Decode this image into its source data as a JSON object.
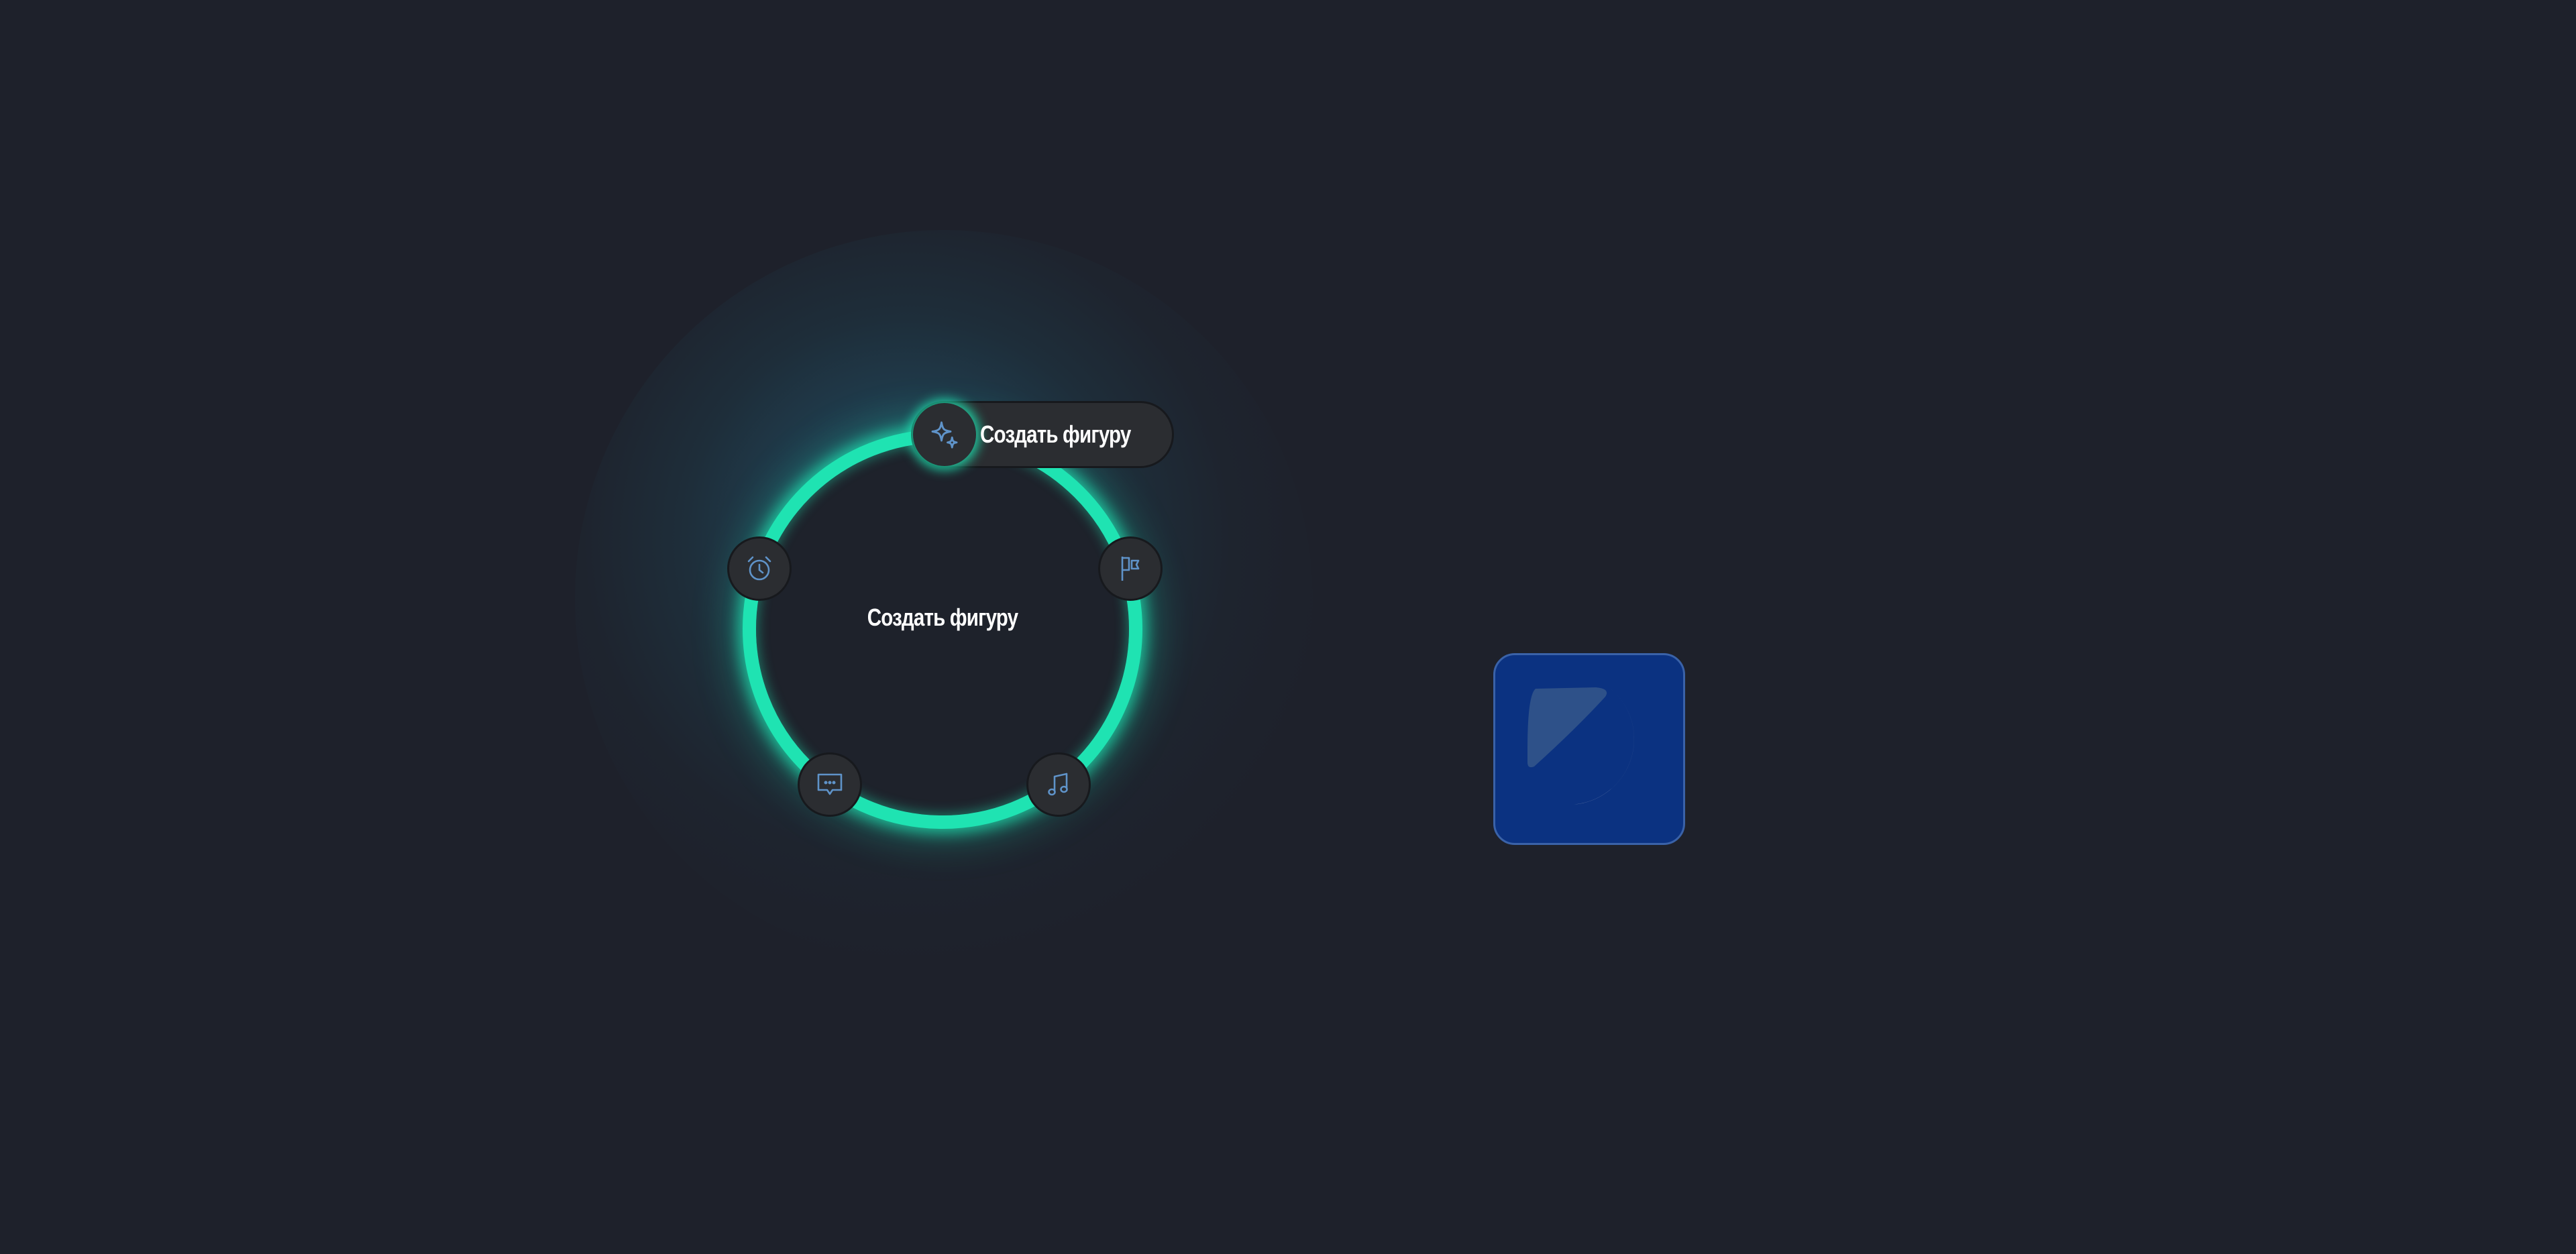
{
  "menu": {
    "center_label": "Создать фигуру",
    "active_item": {
      "label": "Создать фигуру",
      "icon": "sparkles-icon"
    },
    "items": [
      {
        "icon": "alarm-clock-icon"
      },
      {
        "icon": "flag-icon"
      },
      {
        "icon": "chat-bubble-icon"
      },
      {
        "icon": "music-note-icon"
      }
    ]
  },
  "app_icon": {
    "icon": "moon-icon"
  },
  "colors": {
    "background": "#1e212b",
    "ring": "#1fe3b2",
    "icon": "#5f93c9",
    "node": "#2b2d31",
    "tile": "#0b3281"
  }
}
